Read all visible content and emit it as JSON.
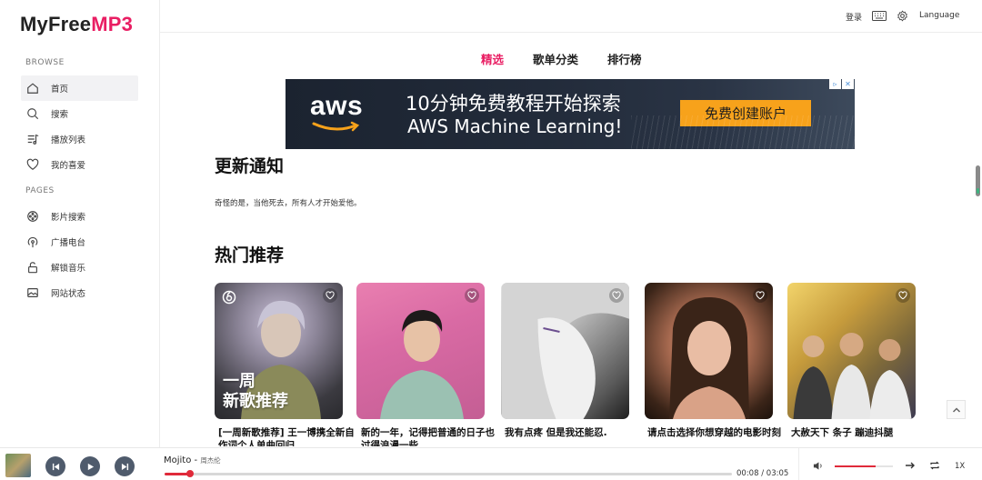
{
  "brand": {
    "part1": "MyFree",
    "part2": "MP3"
  },
  "sidebar": {
    "browse_label": "BROWSE",
    "pages_label": "PAGES",
    "browse_items": [
      {
        "label": "首页",
        "icon": "home-icon"
      },
      {
        "label": "搜索",
        "icon": "search-icon"
      },
      {
        "label": "播放列表",
        "icon": "playlist-icon"
      },
      {
        "label": "我的喜爱",
        "icon": "heart-icon"
      }
    ],
    "page_items": [
      {
        "label": "影片搜索",
        "icon": "film-icon"
      },
      {
        "label": "广播电台",
        "icon": "radio-icon"
      },
      {
        "label": "解锁音乐",
        "icon": "unlock-icon"
      },
      {
        "label": "网站状态",
        "icon": "image-icon"
      }
    ]
  },
  "header": {
    "login": "登录",
    "language": "Language"
  },
  "tabs": [
    {
      "label": "精选",
      "active": true
    },
    {
      "label": "歌单分类",
      "active": false
    },
    {
      "label": "排行榜",
      "active": false
    }
  ],
  "ad": {
    "brand": "aws",
    "line1": "10分钟免费教程开始探索",
    "line2": "AWS Machine Learning!",
    "cta": "免费创建账户"
  },
  "news": {
    "heading": "更新通知",
    "text": "奇怪的是，当他死去，所有人才开始爱他。"
  },
  "hot": {
    "heading": "热门推荐",
    "cards": [
      {
        "title": "[一周新歌推荐] 王一博携全新自作词个人单曲回归",
        "overlay": [
          "一周",
          "新歌推荐"
        ]
      },
      {
        "title": "新的一年，记得把普通的日子也过得浪漫一些",
        "overlay": []
      },
      {
        "title": "我有点疼 但是我还能忍.",
        "overlay": []
      },
      {
        "title": "请点击选择你想穿越的电影时刻",
        "overlay": []
      },
      {
        "title": "大赦天下 条子 蹦迪抖腿",
        "overlay": []
      }
    ]
  },
  "player": {
    "song": "Mojito",
    "artist": "周杰伦",
    "current_time": "00:08",
    "total_time": "03:05",
    "progress": 0.045,
    "volume": 0.7,
    "speed": "1X"
  },
  "colors": {
    "accent": "#e91e63",
    "progress": "#e02a3a",
    "ad_cta": "#f7a21b"
  }
}
